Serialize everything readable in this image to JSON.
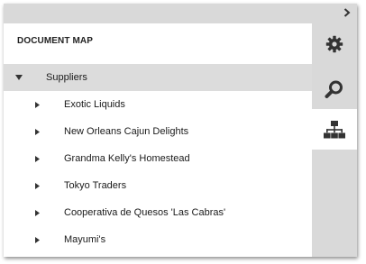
{
  "panel": {
    "title": "DOCUMENT MAP"
  },
  "tree": {
    "root": {
      "label": "Suppliers",
      "expanded": true
    },
    "children": [
      {
        "label": "Exotic Liquids"
      },
      {
        "label": "New Orleans Cajun Delights"
      },
      {
        "label": "Grandma Kelly's Homestead"
      },
      {
        "label": "Tokyo Traders"
      },
      {
        "label": "Cooperativa de Quesos 'Las Cabras'"
      },
      {
        "label": "Mayumi's"
      }
    ]
  },
  "sidebar": {
    "buttons": [
      {
        "icon": "gear-icon",
        "active": false
      },
      {
        "icon": "search-icon",
        "active": false
      },
      {
        "icon": "document-map-icon",
        "active": true
      }
    ]
  },
  "topbar": {
    "icon": "chevron-right-icon"
  },
  "colors": {
    "chrome": "#d9d9d9",
    "panel": "#ffffff",
    "selected_row": "#dcdcdc",
    "icon": "#333333"
  }
}
